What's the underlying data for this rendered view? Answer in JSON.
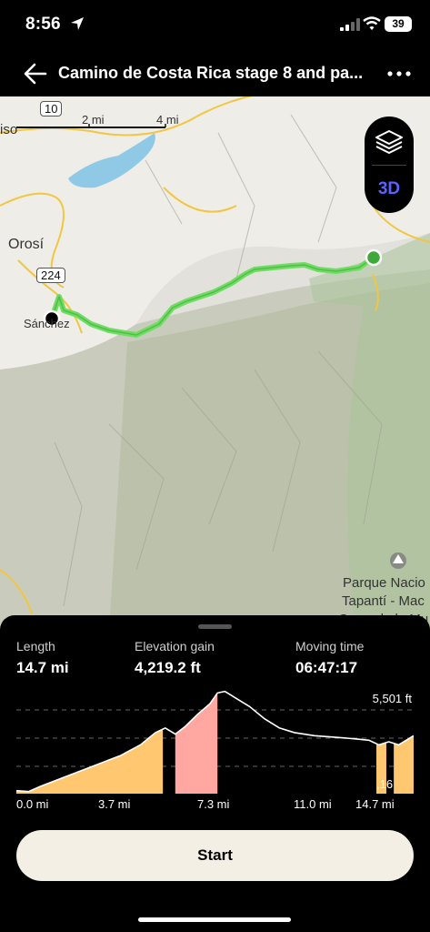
{
  "status": {
    "time": "8:56",
    "battery": "39"
  },
  "header": {
    "title": "Camino de Costa Rica stage 8 and pa..."
  },
  "map": {
    "labels": {
      "iso": "iso",
      "orosi": "Orosí",
      "road_224": "224",
      "road_10": "10",
      "sanchez": "Sánchez",
      "park_1": "Parque Nacio",
      "park_2": "Tapantí - Mac",
      "park_3": "Cerro de la Mu"
    },
    "scale": {
      "a": "2 mi",
      "b": "4 mi"
    },
    "view_3d": "3D"
  },
  "stats": {
    "length_label": "Length",
    "length_value": "14.7 mi",
    "gain_label": "Elevation gain",
    "gain_value": "4,219.2 ft",
    "time_label": "Moving time",
    "time_value": "06:47:17"
  },
  "chart_data": {
    "type": "area",
    "max_label": "5,501 ft",
    "min_label_partial": ",16",
    "x_ticks": [
      "0.0 mi",
      "3.7 mi",
      "7.3 mi",
      "11.0 mi",
      "14.7 mi"
    ],
    "xlim": [
      0,
      16
    ],
    "profile": [
      [
        0,
        2250
      ],
      [
        0.5,
        2220
      ],
      [
        1.0,
        2400
      ],
      [
        1.8,
        2650
      ],
      [
        2.6,
        2900
      ],
      [
        3.4,
        3150
      ],
      [
        4.2,
        3400
      ],
      [
        5.0,
        3750
      ],
      [
        5.6,
        4150
      ],
      [
        6.0,
        4300
      ],
      [
        6.4,
        4100
      ],
      [
        6.8,
        4350
      ],
      [
        7.3,
        4750
      ],
      [
        7.8,
        5100
      ],
      [
        8.1,
        5450
      ],
      [
        8.4,
        5501
      ],
      [
        8.8,
        5300
      ],
      [
        9.4,
        5000
      ],
      [
        10.0,
        4600
      ],
      [
        10.6,
        4300
      ],
      [
        11.2,
        4150
      ],
      [
        12.0,
        4050
      ],
      [
        12.8,
        4000
      ],
      [
        13.6,
        3950
      ],
      [
        14.2,
        3900
      ],
      [
        14.6,
        3750
      ],
      [
        15.0,
        3850
      ],
      [
        15.4,
        3750
      ],
      [
        15.8,
        3950
      ],
      [
        16.0,
        4050
      ]
    ],
    "highlight_segments": [
      {
        "from": 0,
        "to": 5.9,
        "color": "#ffc870"
      },
      {
        "from": 6.4,
        "to": 8.1,
        "color": "#ffa7a0"
      },
      {
        "from": 14.5,
        "to": 14.9,
        "color": "#ffc870"
      },
      {
        "from": 15.2,
        "to": 16.0,
        "color": "#ffc870"
      }
    ]
  },
  "actions": {
    "start": "Start"
  }
}
